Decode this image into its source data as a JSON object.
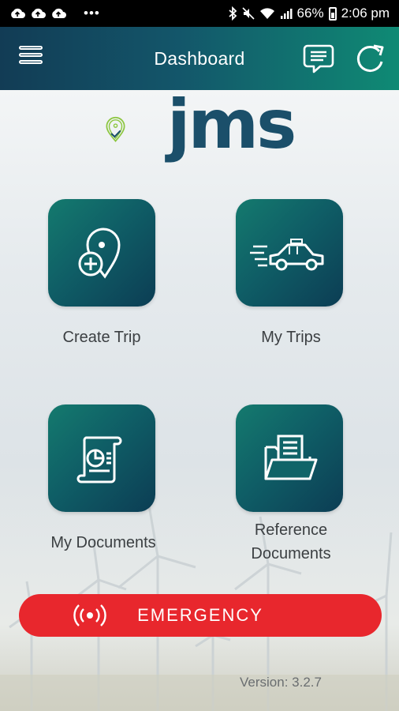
{
  "status_bar": {
    "right_text": "66%",
    "time": "2:06 pm"
  },
  "app_bar": {
    "title": "Dashboard",
    "menu_icon": "hamburger-menu-icon",
    "chat_icon": "chat-icon",
    "refresh_icon": "refresh-icon"
  },
  "logo": {
    "text": "jms"
  },
  "tiles": [
    {
      "label": "Create Trip",
      "icon": "create-trip-icon"
    },
    {
      "label": "My Trips",
      "icon": "car-icon"
    },
    {
      "label": "My Documents",
      "icon": "document-scroll-icon"
    },
    {
      "label_line1": "Reference",
      "label_line2": "Documents",
      "icon": "folder-icon"
    }
  ],
  "emergency": {
    "label": "EMERGENCY",
    "icon": "broadcast-icon",
    "color": "#e8272d"
  },
  "version": "Version: 3.2.7",
  "colors": {
    "app_bar_start": "#123c55",
    "app_bar_end": "#0f8a74",
    "tile": "#0f5e66",
    "logo_text": "#1b4f6a",
    "logo_pin": "#8cc63f"
  }
}
